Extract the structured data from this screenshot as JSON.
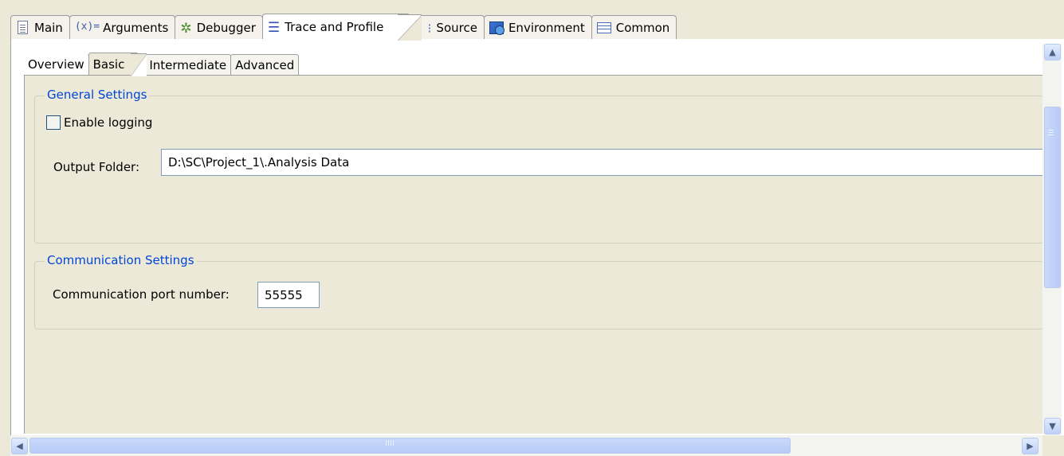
{
  "top_tabs": [
    {
      "label": "Main",
      "icon": "document-icon"
    },
    {
      "label": "Arguments",
      "icon_text": "(x)=",
      "icon": "variable-icon"
    },
    {
      "label": "Debugger",
      "icon": "bug-icon"
    },
    {
      "label": "Trace and Profile",
      "icon": "trace-icon",
      "active": true
    },
    {
      "label": "Source",
      "icon": "source-icon"
    },
    {
      "label": "Environment",
      "icon": "environment-icon"
    },
    {
      "label": "Common",
      "icon": "common-icon"
    }
  ],
  "sub_tabs": [
    {
      "label": "Overview"
    },
    {
      "label": "Basic",
      "active": true
    },
    {
      "label": "Intermediate"
    },
    {
      "label": "Advanced"
    }
  ],
  "general": {
    "title": "General Settings",
    "enable_logging_label": "Enable logging",
    "enable_logging_checked": false,
    "output_folder_label": "Output Folder:",
    "output_folder_value": "D:\\SC\\Project_1\\.Analysis Data"
  },
  "communication": {
    "title": "Communication Settings",
    "port_label": "Communication port number:",
    "port_value": "55555"
  },
  "icons": {
    "bug_glyph": "✲",
    "trace_glyph": "☰",
    "source_glyph": "⁝",
    "scroll_up": "▲",
    "scroll_down": "▼",
    "scroll_left": "◀",
    "scroll_right": "▶"
  }
}
